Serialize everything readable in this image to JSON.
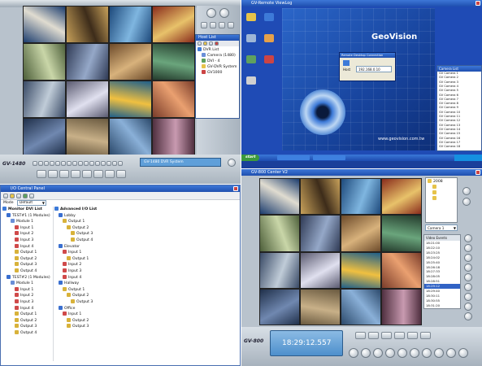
{
  "colors": {
    "accent": "#1f4fb0",
    "panel": "#c7d0d9",
    "desktop": "#1a3f9a",
    "lcd": "#6fa6d6"
  },
  "q1": {
    "brand": "GV-1480",
    "status_text": "GV-1480 DVR System",
    "host_window": {
      "title": "Host List",
      "items": [
        {
          "label": "DVR List"
        },
        {
          "label": "Camera (1480)"
        },
        {
          "label": "DVI - 4"
        },
        {
          "label": "GV-DVR System"
        },
        {
          "label": "GV1000"
        }
      ]
    }
  },
  "q2": {
    "window_title": "GV-Remote ViewLog",
    "brand": "GeoVision",
    "url": "www.geovision.com.tw",
    "dialog": {
      "title": "Remote Desktop Connection",
      "field_label": "Host",
      "field_value": "192.168.0.10"
    },
    "desktop_icons": [
      "My Documents",
      "My Computer",
      "My Network",
      "Recycle Bin",
      "Internet",
      "Outlook",
      "Remote"
    ],
    "right_list_title": "Camera List",
    "right_list": [
      "GV Camera 1",
      "GV Camera 2",
      "GV Camera 3",
      "GV Camera 4",
      "GV Camera 5",
      "GV Camera 6",
      "GV Camera 7",
      "GV Camera 8",
      "GV Camera 9",
      "GV Camera 10",
      "GV Camera 11",
      "GV Camera 12",
      "GV Camera 13",
      "GV Camera 14",
      "GV Camera 15",
      "GV Camera 16",
      "GV Camera 17",
      "GV Camera 18"
    ],
    "taskbar_start": "start"
  },
  "q3": {
    "window_title": "I/O Central Panel",
    "mode_label": "Mode",
    "mode_value": "Default",
    "left_header": "Monitor DVI List",
    "right_header": "Advanced I/O List",
    "left_tree": [
      {
        "label": "TEST#1 (1 Modules)",
        "level": 1,
        "color": "#3a6fd0"
      },
      {
        "label": "Module 1",
        "level": 2,
        "color": "#6a8fd8"
      },
      {
        "label": "Input 1",
        "level": 3,
        "color": "#d04a4a"
      },
      {
        "label": "Input 2",
        "level": 3,
        "color": "#d04a4a"
      },
      {
        "label": "Input 3",
        "level": 3,
        "color": "#d04a4a"
      },
      {
        "label": "Input 4",
        "level": 3,
        "color": "#d04a4a"
      },
      {
        "label": "Output 1",
        "level": 3,
        "color": "#d8b23a"
      },
      {
        "label": "Output 2",
        "level": 3,
        "color": "#d8b23a"
      },
      {
        "label": "Output 3",
        "level": 3,
        "color": "#d8b23a"
      },
      {
        "label": "Output 4",
        "level": 3,
        "color": "#d8b23a"
      },
      {
        "label": "TEST#2 (1 Modules)",
        "level": 1,
        "color": "#3a6fd0"
      },
      {
        "label": "Module 1",
        "level": 2,
        "color": "#6a8fd8"
      },
      {
        "label": "Input 1",
        "level": 3,
        "color": "#d04a4a"
      },
      {
        "label": "Input 2",
        "level": 3,
        "color": "#d04a4a"
      },
      {
        "label": "Input 3",
        "level": 3,
        "color": "#d04a4a"
      },
      {
        "label": "Input 4",
        "level": 3,
        "color": "#d04a4a"
      },
      {
        "label": "Output 1",
        "level": 3,
        "color": "#d8b23a"
      },
      {
        "label": "Output 2",
        "level": 3,
        "color": "#d8b23a"
      },
      {
        "label": "Output 3",
        "level": 3,
        "color": "#d8b23a"
      },
      {
        "label": "Output 4",
        "level": 3,
        "color": "#d8b23a"
      }
    ],
    "right_tree": [
      {
        "label": "Lobby",
        "level": 1,
        "color": "#3a6fd0"
      },
      {
        "label": "Output 1",
        "level": 2,
        "color": "#d8b23a"
      },
      {
        "label": "Output 2",
        "level": 3,
        "color": "#d8b23a"
      },
      {
        "label": "Output 3",
        "level": 4,
        "color": "#d8b23a"
      },
      {
        "label": "Output 4",
        "level": 4,
        "color": "#d8b23a"
      },
      {
        "label": "Elevator",
        "level": 1,
        "color": "#3a6fd0"
      },
      {
        "label": "Input 1",
        "level": 2,
        "color": "#d04a4a"
      },
      {
        "label": "Output 1",
        "level": 3,
        "color": "#d8b23a"
      },
      {
        "label": "Input 2",
        "level": 2,
        "color": "#d04a4a"
      },
      {
        "label": "Input 3",
        "level": 2,
        "color": "#d04a4a"
      },
      {
        "label": "Input 4",
        "level": 2,
        "color": "#d04a4a"
      },
      {
        "label": "Hallway",
        "level": 1,
        "color": "#3a6fd0"
      },
      {
        "label": "Output 1",
        "level": 2,
        "color": "#d8b23a"
      },
      {
        "label": "Output 2",
        "level": 3,
        "color": "#d8b23a"
      },
      {
        "label": "Output 3",
        "level": 4,
        "color": "#d8b23a"
      },
      {
        "label": "Office",
        "level": 1,
        "color": "#3a6fd0"
      },
      {
        "label": "Input 1",
        "level": 2,
        "color": "#d04a4a"
      },
      {
        "label": "Output 2",
        "level": 3,
        "color": "#d8b23a"
      },
      {
        "label": "Output 3",
        "level": 3,
        "color": "#d8b23a"
      }
    ]
  },
  "q4": {
    "window_title": "GV-800 Center V2",
    "brand": "GV-800",
    "clock": "18:29:12.557",
    "camera_select": "Camera 1",
    "tree_root": "2008",
    "video_events_title": "Video Events",
    "events": [
      "18:21:00",
      "18:22:10",
      "18:23:25",
      "18:24:02",
      "18:25:40",
      "18:26:18",
      "18:27:33",
      "18:28:05",
      "18:28:51",
      "18:29:12",
      "18:29:40",
      "18:30:11",
      "18:30:55",
      "18:31:20"
    ],
    "selected_event_index": 9
  }
}
